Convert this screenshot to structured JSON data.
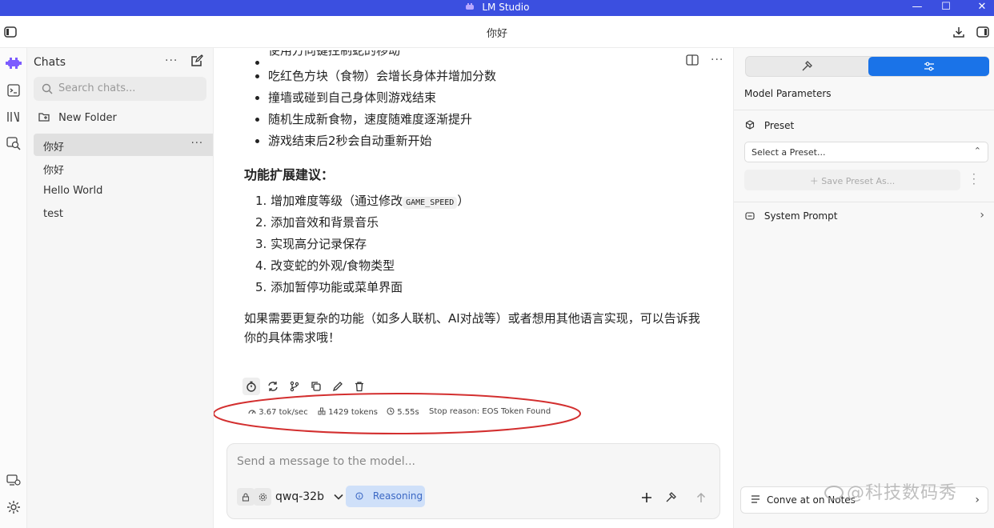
{
  "window": {
    "title": "LM Studio",
    "minimize": "—",
    "maximize": "☐",
    "close": "✕"
  },
  "topbar": {
    "title": "你好"
  },
  "sidebar": {
    "title": "Chats",
    "search_placeholder": "Search chats...",
    "new_folder": "New Folder",
    "chats": [
      {
        "label": "你好",
        "active": true
      },
      {
        "label": "你好",
        "active": false
      },
      {
        "label": "Hello World",
        "active": false
      },
      {
        "label": "test",
        "active": false
      }
    ]
  },
  "message": {
    "cut_line": "使用方向键控制蛇的移动",
    "bullets": [
      "吃红色方块（食物）会增长身体并增加分数",
      "撞墙或碰到自己身体则游戏结束",
      "随机生成新食物，速度随难度逐渐提升",
      "游戏结束后2秒会自动重新开始"
    ],
    "heading": "功能扩展建议：",
    "list": [
      {
        "num": "1.",
        "text": "增加难度等级（通过修改",
        "code": "GAME_SPEED",
        "after": "）"
      },
      {
        "num": "2.",
        "text": "添加音效和背景音乐"
      },
      {
        "num": "3.",
        "text": "实现高分记录保存"
      },
      {
        "num": "4.",
        "text": "改变蛇的外观/食物类型"
      },
      {
        "num": "5.",
        "text": "添加暂停功能或菜单界面"
      }
    ],
    "closing": "如果需要更复杂的功能（如多人联机、AI对战等）或者想用其他语言实现，可以告诉我你的具体需求哦！"
  },
  "stats": {
    "speed": "3.67 tok/sec",
    "tokens": "1429 tokens",
    "time": "5.55s",
    "stop_reason": "Stop reason: EOS Token Found"
  },
  "composer": {
    "placeholder": "Send a message to the model...",
    "model": "qwq-32b",
    "reasoning": "Reasoning"
  },
  "right_panel": {
    "section_title": "Model Parameters",
    "preset_label": "Preset",
    "preset_select": "Select a Preset...",
    "save_preset": "Save Preset As...",
    "system_prompt": "System Prompt",
    "conversation_notes": "Conve  at on Notes"
  },
  "watermark": "@科技数码秀",
  "colors": {
    "titlebar": "#3b4fe0",
    "accent": "#1a73e8",
    "reasoning_bg": "#cfe0f9",
    "ellipse": "#d32f2f"
  }
}
